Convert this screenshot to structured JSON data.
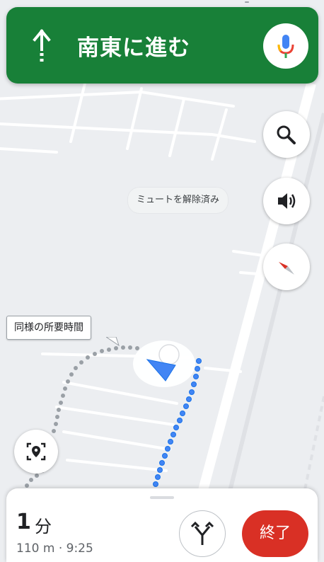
{
  "navigation": {
    "instruction": "南東に進む",
    "direction_icon": "straight-arrow-icon",
    "mic_icon": "microphone-icon",
    "banner_color": "#188038"
  },
  "map_controls": {
    "search_icon": "search-icon",
    "sound_icon": "speaker-icon",
    "compass_icon": "compass-icon",
    "mute_status": "ミュートを解除済み"
  },
  "map": {
    "alternative_route_label": "同様の所要時間",
    "route_color": "#4285f4",
    "alt_route_color": "#9aa0a6"
  },
  "recenter_icon": "recenter-location-icon",
  "bottom_sheet": {
    "eta_value": "1",
    "eta_unit": "分",
    "trip_info": "110 m · 9:25",
    "routes_icon": "alternate-routes-icon",
    "exit_label": "終了",
    "exit_color": "#d93025"
  }
}
